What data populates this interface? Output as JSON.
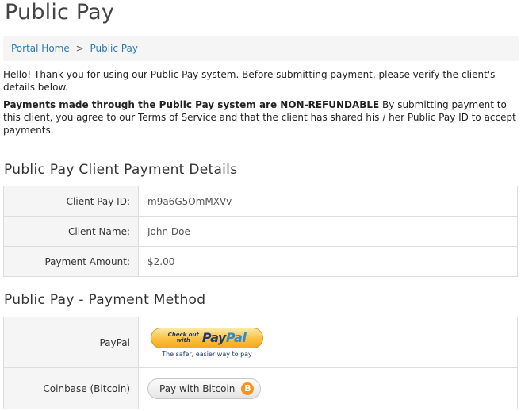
{
  "header": {
    "title": "Public Pay"
  },
  "breadcrumb": {
    "home": "Portal Home",
    "separator": ">",
    "current": "Public Pay"
  },
  "intro": "Hello! Thank you for using our Public Pay system. Before submitting payment, please verify the client's details below.",
  "notice": {
    "bold": "Payments made through the Public Pay system are NON-REFUNDABLE",
    "rest": " By submitting payment to this client, you agree to our Terms of Service and that the client has shared his / her Public Pay ID to accept payments."
  },
  "details": {
    "title": "Public Pay Client Payment Details",
    "rows": [
      {
        "label": "Client Pay ID:",
        "value": "m9a6G5OmMXVv"
      },
      {
        "label": "Client Name:",
        "value": "John Doe"
      },
      {
        "label": "Payment Amount:",
        "value": "$2.00"
      }
    ]
  },
  "methods": {
    "title": "Public Pay - Payment Method",
    "paypal": {
      "label": "PayPal",
      "checkout_line1": "Check out",
      "checkout_line2": "with",
      "logo_pay": "Pay",
      "logo_pal": "Pal",
      "tagline": "The safer, easier way to pay"
    },
    "bitcoin": {
      "label": "Coinbase (Bitcoin)",
      "button_label": "Pay with Bitcoin",
      "icon_glyph": "B",
      "icon_color": "#f7931a"
    }
  },
  "colors": {
    "link": "#2a7ab0",
    "paypal_gold": "#fbc040",
    "paypal_blue": "#1a3877"
  }
}
